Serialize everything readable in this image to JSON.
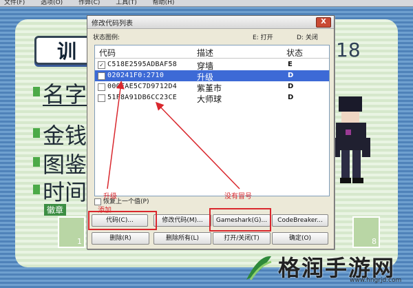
{
  "menubar": [
    "文件(F)",
    "选项(O)",
    "作弊(C)",
    "工具(T)",
    "帮助(H)"
  ],
  "game": {
    "trainer_title": "训",
    "trainer_number": "18",
    "labels": {
      "name": "名字",
      "money": "金钱",
      "pokedex": "图鉴",
      "time": "时间"
    },
    "badge": "徽章",
    "card_left": "1",
    "card_right": "8"
  },
  "dialog": {
    "title": "修改代码列表",
    "close": "X",
    "legend_label": "状态图例:",
    "legend_on": "E: 打开",
    "legend_off": "D: 关闭",
    "columns": [
      "代码",
      "描述",
      "状态"
    ],
    "rows": [
      {
        "checked": true,
        "code": "C518E2595ADBAF58",
        "desc": "穿墙",
        "state": "E",
        "selected": false
      },
      {
        "checked": false,
        "code": "020241F0:2710",
        "desc": "升级",
        "state": "D",
        "selected": true
      },
      {
        "checked": false,
        "code": "000FAE5C7D9712D4",
        "desc": "紫堇市",
        "state": "D",
        "selected": false
      },
      {
        "checked": false,
        "code": "51F8A91DB6CC23CE",
        "desc": "大师球",
        "state": "D",
        "selected": false
      }
    ],
    "check_prev": "恢复上一个值(P)",
    "buttons": {
      "code": "代码(C)...",
      "modify": "修改代码(M)...",
      "gameshark": "Gameshark(G)...",
      "codebreaker": "CodeBreaker...",
      "delete": "删除(R)",
      "delete_all": "删除所有(L)",
      "toggle": "打开/关闭(T)",
      "ok": "确定(O)"
    }
  },
  "annotations": {
    "upgrade": "升级",
    "add": "添加",
    "no_colon": "没有冒号"
  },
  "watermark": {
    "text": "格润手游网",
    "url": "www.hngrjd.com"
  },
  "colors": {
    "accent_red": "#d9272d",
    "selection": "#3d6ad6"
  }
}
